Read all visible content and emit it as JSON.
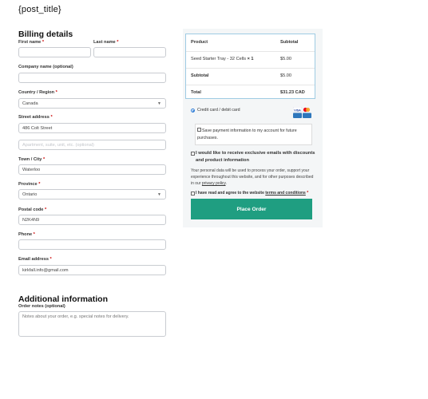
{
  "post_title": "{post_title}",
  "billing": {
    "heading": "Billing details",
    "first_name_label": "First name",
    "last_name_label": "Last name",
    "company_label": "Company name (optional)",
    "country_label": "Country / Region",
    "country_value": "Canada",
    "street_label": "Street address",
    "street_value": "486 Colt Street",
    "apartment_placeholder": "Apartment, suite, unit, etc. (optional)",
    "city_label": "Town / City",
    "city_value": "Waterloo",
    "province_label": "Province",
    "province_value": "Ontario",
    "postal_label": "Postal code",
    "postal_value": "N2K4N9",
    "phone_label": "Phone",
    "email_label": "Email address",
    "email_value": "kirkfall.info@gmail.com",
    "required_mark": "*"
  },
  "additional": {
    "heading": "Additional information",
    "notes_label": "Order notes (optional)",
    "notes_placeholder": "Notes about your order, e.g. special notes for delivery."
  },
  "order": {
    "col_product": "Product",
    "col_subtotal": "Subtotal",
    "item_name": "Seed Starter Tray - 32 Cells",
    "item_qty": "× 1",
    "item_price": "$5.00",
    "subtotal_label": "Subtotal",
    "subtotal_value": "$5.00",
    "total_label": "Total",
    "total_value": "$31.23 CAD"
  },
  "payment": {
    "method_label": "Credit card / debit card",
    "card_brands": [
      "VISA",
      "Mastercard",
      "AMEX"
    ],
    "save_info_label": "Save payment information to my account for future purchases.",
    "newsletter_label": "I would like to receive exclusive emails with discounts and product information",
    "privacy_text": "Your personal data will be used to process your order, support your experience throughout this website, and for other purposes described in our",
    "privacy_link": "privacy policy",
    "terms_prefix": "I have read and agree to the website",
    "terms_link": "terms and conditions",
    "place_order": "Place Order"
  },
  "colors": {
    "place_order_bg": "#1f9e81",
    "radio_accent": "#2b7bd6",
    "table_border": "#9ecbe3"
  }
}
